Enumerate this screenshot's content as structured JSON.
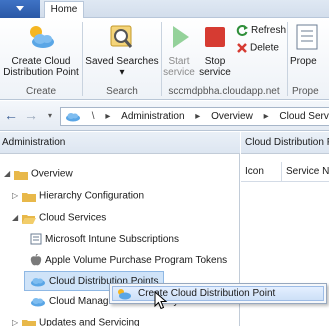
{
  "ribbon": {
    "tabs": {
      "home": "Home"
    },
    "groups": {
      "create": {
        "label": "Create",
        "create_cdp": "Create Cloud Distribution Point"
      },
      "search": {
        "label": "Search",
        "saved_searches": "Saved Searches",
        "saved_searches_caret": "▾"
      },
      "cdp": {
        "label": "sccmdpbha.cloudapp.net",
        "start_service": "Start service",
        "stop_service": "Stop service",
        "refresh": "Refresh",
        "delete": "Delete"
      },
      "properties": {
        "label": "Prope",
        "properties": "Prope"
      }
    }
  },
  "address": {
    "back": "←",
    "forward": "→",
    "root_sep": "\\",
    "crumbs": [
      "Administration",
      "Overview",
      "Cloud Services"
    ],
    "separator": "▸"
  },
  "nav": {
    "header": "Administration",
    "items": [
      {
        "label": "Overview",
        "expander": "◢"
      },
      {
        "label": "Hierarchy Configuration",
        "expander": "▷"
      },
      {
        "label": "Cloud Services",
        "expander": "◢"
      },
      {
        "label": "Microsoft Intune Subscriptions"
      },
      {
        "label": "Apple Volume Purchase Program Tokens"
      },
      {
        "label": "Cloud Distribution Points"
      },
      {
        "label": "Cloud Management Gateway"
      },
      {
        "label": "Updates and Servicing",
        "expander": "▷"
      }
    ]
  },
  "list": {
    "header": "Cloud Distribution Points",
    "columns": [
      "Icon",
      "Service Name"
    ]
  },
  "context_menu": {
    "items": [
      {
        "label": "Create Cloud Distribution Point"
      }
    ]
  },
  "colors": {
    "accent": "#2a58a6",
    "selection": "#cfe3f8",
    "folder": "#e8b84a",
    "play": "#3fae49",
    "stop": "#d63b32"
  }
}
